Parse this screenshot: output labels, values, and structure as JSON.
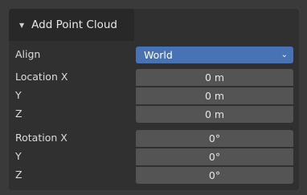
{
  "panel": {
    "title": "Add Point Cloud",
    "collapse_glyph": "▼"
  },
  "align": {
    "label": "Align",
    "value": "World",
    "chevron_glyph": "⌄"
  },
  "location": {
    "x_label": "Location X",
    "y_label": "Y",
    "z_label": "Z",
    "x_value": "0 m",
    "y_value": "0 m",
    "z_value": "0 m"
  },
  "rotation": {
    "x_label": "Rotation X",
    "y_label": "Y",
    "z_label": "Z",
    "x_value": "0°",
    "y_value": "0°",
    "z_value": "0°"
  },
  "colors": {
    "accent": "#4772b3",
    "field_bg": "#545454",
    "panel_bg": "#303030"
  }
}
